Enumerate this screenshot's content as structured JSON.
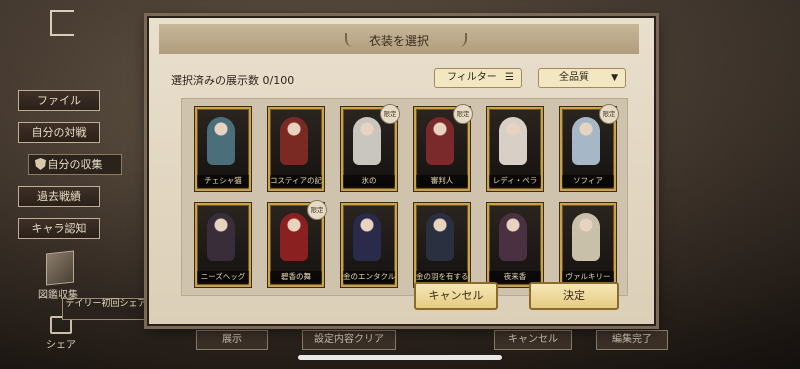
{
  "sidebar": {
    "items": [
      {
        "label": "ファイル"
      },
      {
        "label": "自分の対戦"
      },
      {
        "label": "自分の収集"
      },
      {
        "label": "過去戦績"
      },
      {
        "label": "キャラ認知"
      }
    ],
    "album_label": "図鑑収集",
    "share_label": "シェア",
    "tooltip": "デイリー初回シェア"
  },
  "bottom_bar": {
    "buttons": [
      {
        "label": "展示"
      },
      {
        "label": "設定内容クリア"
      },
      {
        "label": "キャンセル"
      },
      {
        "label": "編集完了"
      }
    ]
  },
  "modal": {
    "title": "衣装を選択",
    "selected_count_text": "選択済みの展示数 0/100",
    "filter_label": "フィルター",
    "quality_label": "全品質",
    "cancel_label": "キャンセル",
    "confirm_label": "決定",
    "cards": [
      {
        "name": "チェシャ猫",
        "badge": "",
        "color": "#4a6f7a"
      },
      {
        "name": "コスティアの記憶",
        "badge": "",
        "color": "#7a2a22"
      },
      {
        "name": "氷の",
        "badge": "限定",
        "color": "#c9c6c0"
      },
      {
        "name": "審判人",
        "badge": "限定",
        "color": "#7a2a2a"
      },
      {
        "name": "レディ・ペラ",
        "badge": "",
        "color": "#d8d0c6"
      },
      {
        "name": "ソフィア",
        "badge": "限定",
        "color": "#a6b8c8"
      },
      {
        "name": "ニーズヘッグ",
        "badge": "",
        "color": "#3a2d3a"
      },
      {
        "name": "碧香の舞",
        "badge": "限定",
        "color": "#8a2020"
      },
      {
        "name": "金のエンタクル",
        "badge": "",
        "color": "#2a2a4a"
      },
      {
        "name": "金の羽を有する者",
        "badge": "",
        "color": "#2a3040"
      },
      {
        "name": "夜来香",
        "badge": "",
        "color": "#4a3040"
      },
      {
        "name": "ヴァルキリー",
        "badge": "",
        "color": "#c8c0a8"
      }
    ]
  },
  "colors": {
    "accent": "#c9a24a",
    "panel": "#e9dfcd"
  }
}
